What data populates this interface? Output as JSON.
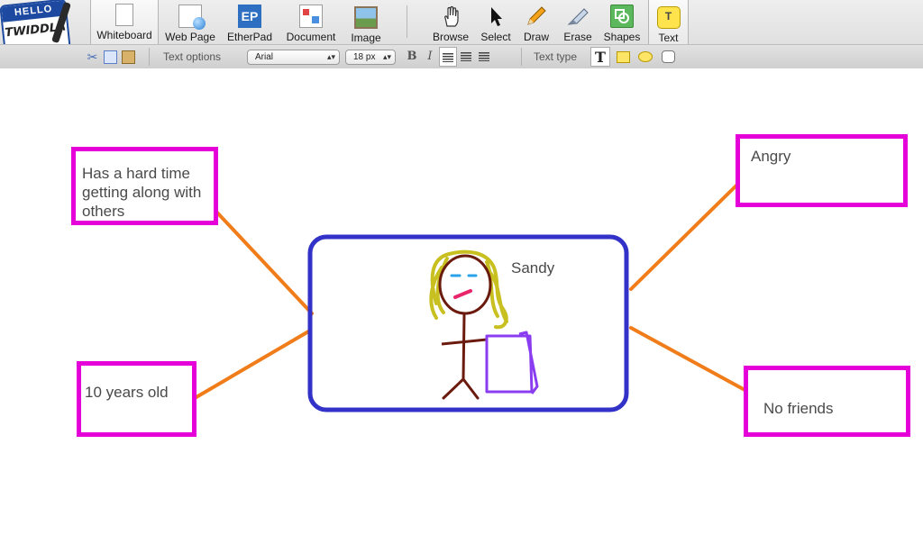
{
  "app": {
    "logo_top": "HELLO",
    "logo_name": "TWIDDLA"
  },
  "tools": {
    "whiteboard": "Whiteboard",
    "web_page": "Web Page",
    "etherpad": "EtherPad",
    "etherpad_icon": "EP",
    "document": "Document",
    "image": "Image",
    "browse": "Browse",
    "select": "Select",
    "draw": "Draw",
    "erase": "Erase",
    "shapes": "Shapes",
    "text": "Text",
    "text_icon": "T"
  },
  "text_options": {
    "label": "Text options",
    "font": "Arial",
    "size": "18 px",
    "bold": "B",
    "italic": "I",
    "type_label": "Text type"
  },
  "canvas": {
    "notes": {
      "hard_time": [
        "Has a hard time",
        "getting along with",
        "others"
      ],
      "ten_years": "10 years old",
      "angry": "Angry",
      "no_friends": "No friends"
    },
    "center_label": "Sandy",
    "colors": {
      "note_border": "#e500d9",
      "center_border": "#3232c8",
      "connector": "#f07c1a",
      "hair": "#c8c020",
      "body": "#6b1a0e",
      "eyes": "#29a3e8",
      "mouth": "#e8246a",
      "bag": "#8a3cf0"
    }
  }
}
